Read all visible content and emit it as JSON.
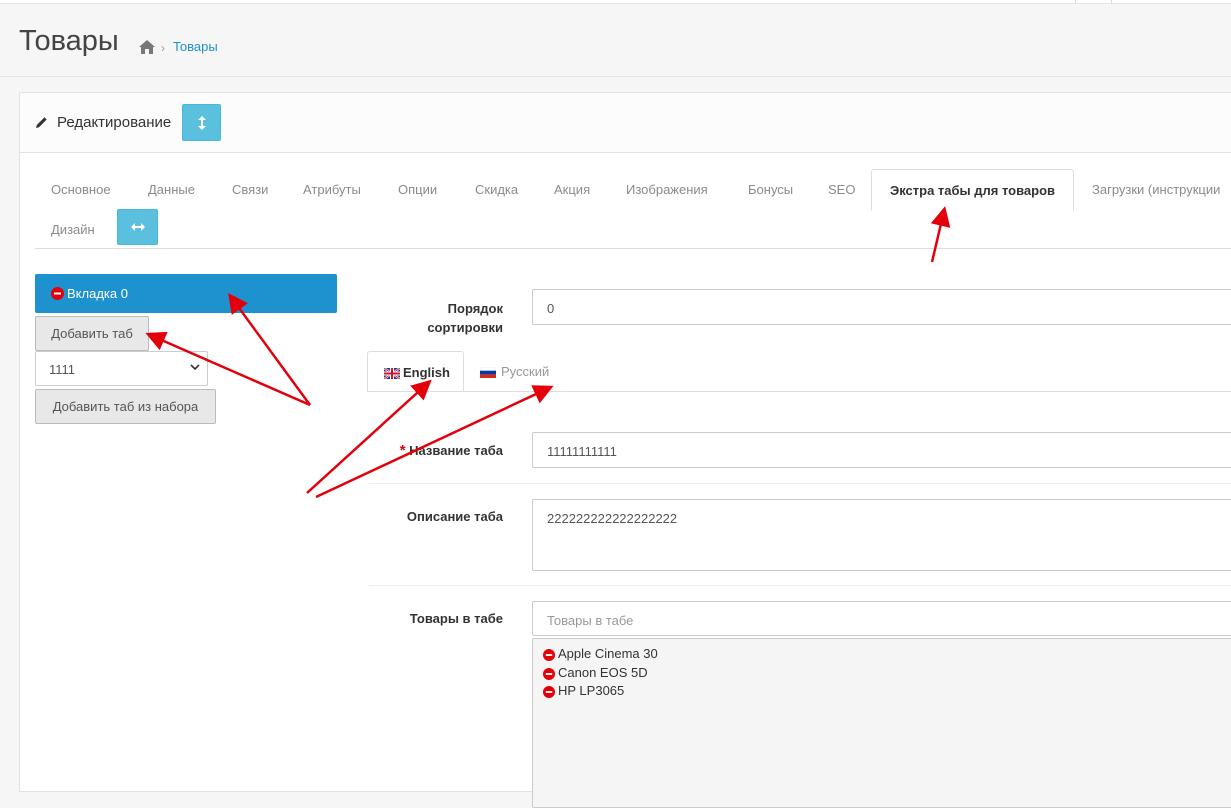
{
  "header": {
    "title": "Товары",
    "breadcrumb_sep": "›",
    "breadcrumb_link": "Товары"
  },
  "panel": {
    "title": "Редактирование"
  },
  "tabs": [
    {
      "label": "Основное"
    },
    {
      "label": "Данные"
    },
    {
      "label": "Связи"
    },
    {
      "label": "Атрибуты"
    },
    {
      "label": "Опции"
    },
    {
      "label": "Скидка"
    },
    {
      "label": "Акция"
    },
    {
      "label": "Изображения"
    },
    {
      "label": "Бонусы"
    },
    {
      "label": "SEO"
    },
    {
      "label": "Экстра табы для товаров",
      "active": true
    },
    {
      "label": "Загрузки (инструкции"
    },
    {
      "label": "Дизайн"
    }
  ],
  "left": {
    "tab_item": "Вкладка 0",
    "add_tab_button": "Добавить таб",
    "set_select_value": "1111",
    "add_from_set_button": "Добавить таб из набора"
  },
  "form": {
    "sort_order_label": "Порядок сортировки",
    "sort_order_value": "0",
    "languages": [
      {
        "label": "English",
        "active": true
      },
      {
        "label": "Русский",
        "active": false
      }
    ],
    "required_mark": "*",
    "tab_name_label": "Название таба",
    "tab_name_value": "11111111111",
    "tab_desc_label": "Описание таба",
    "tab_desc_value": "222222222222222222",
    "products_label": "Товары в табе",
    "products_placeholder": "Товары в табе",
    "products": [
      "Apple Cinema 30",
      "Canon EOS 5D",
      "HP LP3065"
    ]
  },
  "colors": {
    "primary": "#1e91cf",
    "info": "#5bc0de",
    "danger": "#e3000b",
    "annotation_arrow": "#e3000b"
  }
}
